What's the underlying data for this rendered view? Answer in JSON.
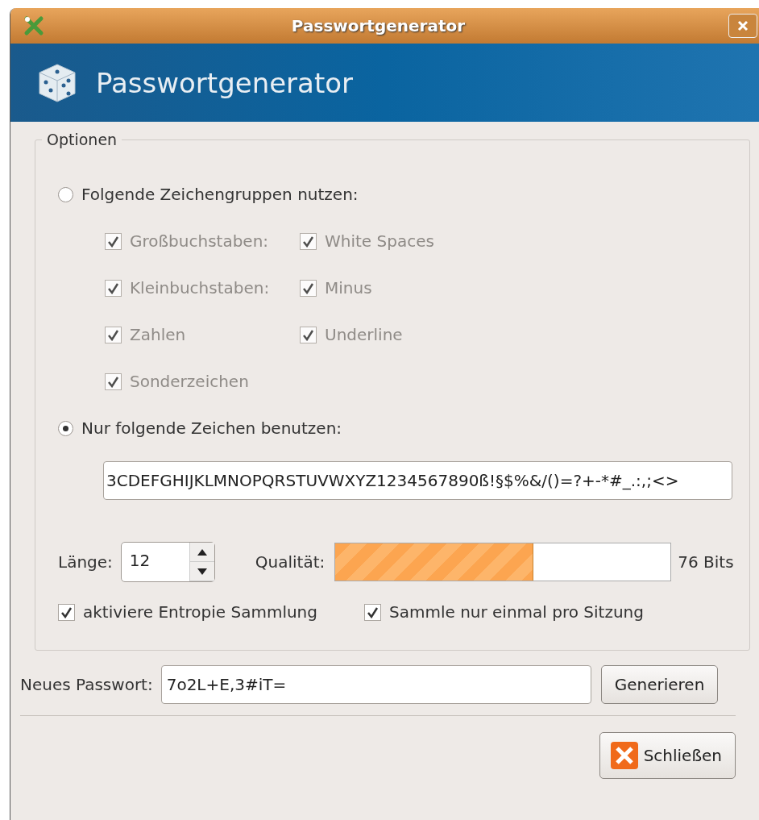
{
  "window": {
    "title": "Passwortgenerator"
  },
  "header": {
    "title": "Passwortgenerator"
  },
  "options": {
    "legend": "Optionen",
    "modes": [
      {
        "label": "Folgende Zeichengruppen nutzen:",
        "selected": false
      },
      {
        "label": "Nur folgende Zeichen benutzen:",
        "selected": true
      }
    ],
    "groups": [
      {
        "label": "Großbuchstaben:",
        "checked": true,
        "disabled": true
      },
      {
        "label": "White Spaces",
        "checked": true,
        "disabled": true
      },
      {
        "label": "Kleinbuchstaben:",
        "checked": true,
        "disabled": true
      },
      {
        "label": "Minus",
        "checked": true,
        "disabled": true
      },
      {
        "label": "Zahlen",
        "checked": true,
        "disabled": true
      },
      {
        "label": "Underline",
        "checked": true,
        "disabled": true
      },
      {
        "label": "Sonderzeichen",
        "checked": true,
        "disabled": true
      }
    ],
    "characters": "3CDEFGHIJKLMNOPQRSTUVWXYZ1234567890ß!§$%&/()=?+-*#_.:,;<>",
    "length_label": "Länge:",
    "length": "12",
    "quality_label": "Qualität:",
    "quality": {
      "level": 0.59,
      "reading": "76 Bits"
    },
    "flags": [
      {
        "label": "aktiviere Entropie Sammlung",
        "checked": true
      },
      {
        "label": "Sammle nur einmal pro Sitzung",
        "checked": true
      }
    ]
  },
  "password": {
    "label": "Neues Passwort:",
    "value": "7o2L+E,3#iT=",
    "button": "Generieren"
  },
  "buttons": [
    "Schließen"
  ]
}
